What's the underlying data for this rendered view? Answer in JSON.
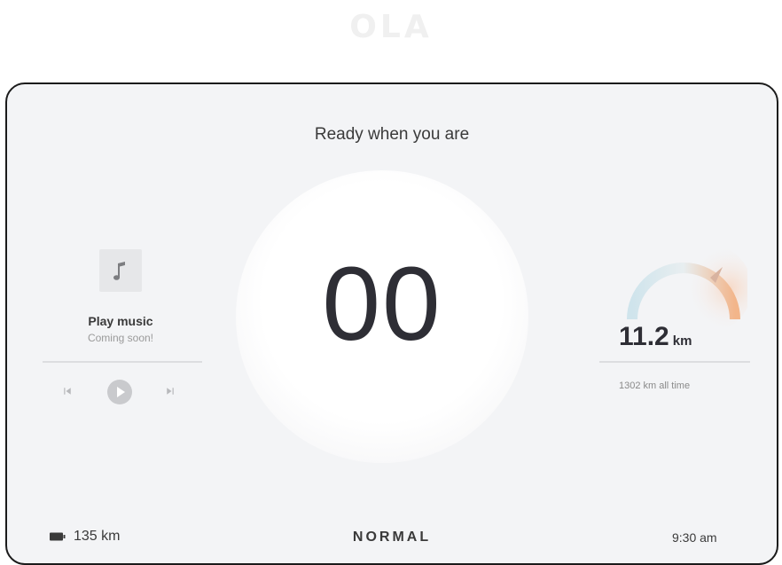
{
  "brand": {
    "logo_text": "OLA"
  },
  "header": {
    "title": "Ready when you are"
  },
  "speedometer": {
    "speed": "00"
  },
  "music": {
    "icon": "music-note-icon",
    "label": "Play music",
    "sub_label": "Coming soon!",
    "controls": [
      "previous-track-icon",
      "play-icon",
      "next-track-icon"
    ]
  },
  "trip": {
    "distance_value": "11.2",
    "distance_unit": "km",
    "total_text": "1302 km all time"
  },
  "status_bar": {
    "range_text": "135 km",
    "mode": "NORMAL",
    "time": "9:30 am"
  },
  "colors": {
    "background": "#f3f4f6",
    "text_dark": "#2e2e35",
    "gauge_warm": "#f2b58a",
    "gauge_cool": "#b9d7e6"
  }
}
